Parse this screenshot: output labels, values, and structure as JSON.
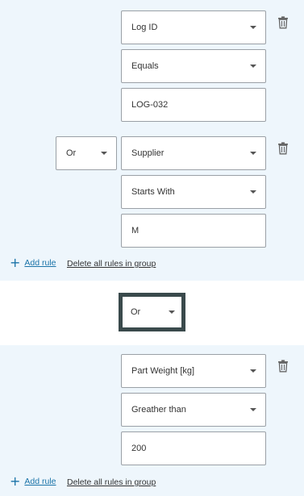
{
  "groups": [
    {
      "rules": [
        {
          "combinator": null,
          "field": "Log ID",
          "operator": "Equals",
          "value": "LOG-032"
        },
        {
          "combinator": "Or",
          "field": "Supplier",
          "operator": "Starts With",
          "value": "M"
        }
      ],
      "add_rule_label": "Add rule",
      "delete_all_label": "Delete all rules in group"
    },
    {
      "rules": [
        {
          "combinator": null,
          "field": "Part Weight [kg]",
          "operator": "Greather than",
          "value": "200"
        }
      ],
      "add_rule_label": "Add rule",
      "delete_all_label": "Delete all rules in group"
    }
  ],
  "group_combinator": "Or",
  "icons": {
    "delete": "trash-icon",
    "add": "plus-icon",
    "dropdown": "chevron-down-icon"
  }
}
